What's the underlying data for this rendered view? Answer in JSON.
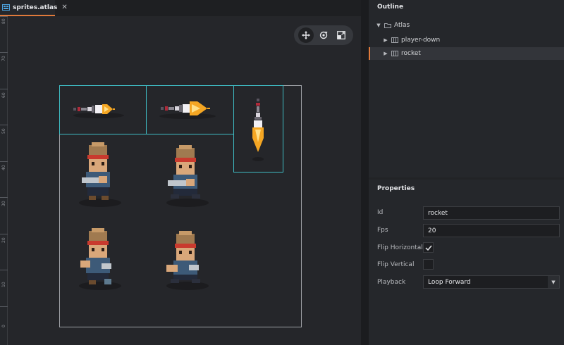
{
  "tab": {
    "title": "sprites.atlas",
    "close": "✕"
  },
  "ruler": {
    "labels": [
      "80",
      "70",
      "60",
      "50",
      "40",
      "30",
      "20",
      "10",
      "0"
    ]
  },
  "toolbar": {
    "tools": [
      "move-icon",
      "rotate-icon",
      "scale-icon"
    ],
    "active": 0
  },
  "outline": {
    "title": "Outline",
    "root": {
      "label": "Atlas",
      "icon": "folder-icon",
      "expanded": true
    },
    "items": [
      {
        "label": "player-down",
        "icon": "animation-icon",
        "selected": false
      },
      {
        "label": "rocket",
        "icon": "animation-icon",
        "selected": true
      }
    ]
  },
  "properties": {
    "title": "Properties",
    "id_label": "Id",
    "id_value": "rocket",
    "fps_label": "Fps",
    "fps_value": "20",
    "flip_h_label": "Flip Horizontal",
    "flip_h_checked": true,
    "flip_v_label": "Flip Vertical",
    "flip_v_checked": false,
    "playback_label": "Playback",
    "playback_value": "Loop Forward"
  },
  "colors": {
    "accent": "#e07a3b",
    "frame": "#3fbcc4",
    "flame": "#f5a623"
  }
}
